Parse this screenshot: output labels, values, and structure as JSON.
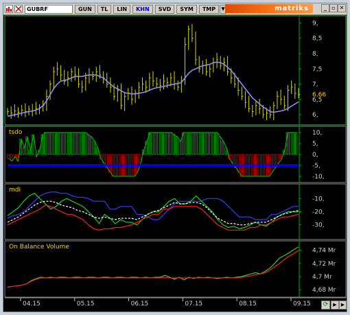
{
  "toolbar": {
    "symbol": "GUBRF",
    "buttons": [
      {
        "label": "GUN",
        "active": false
      },
      {
        "label": "TL",
        "active": false
      },
      {
        "label": "LIN",
        "active": false
      },
      {
        "label": "KHN",
        "active": true
      },
      {
        "label": "SVD",
        "active": false
      },
      {
        "label": "SYM",
        "active": false
      },
      {
        "label": "TMP",
        "active": false
      }
    ],
    "brand": "matriks",
    "dropdown_glyph": "▼",
    "refresh_glyph": "⟳"
  },
  "colors": {
    "price_bars": "#d8d800",
    "moving_average": "#8f8fff",
    "tsdo_up": "#00c000",
    "tsdo_down": "#e00000",
    "tsdo_signal": "#0000ff",
    "mdi_blue": "#3040ff",
    "mdi_green": "#20d020",
    "mdi_red": "#ff2020",
    "mdi_mid": "#ffffff",
    "obv_green": "#30d030",
    "obv_red": "#ff2020",
    "axis": "#00b000",
    "last_price": "#ffd000"
  },
  "chart_data": [
    {
      "type": "line",
      "name": "price",
      "xtick_labels": [
        "04.15",
        "05.15",
        "06.15",
        "07.15",
        "08.15",
        "09.15"
      ],
      "yticks": [
        "9,",
        "8,5",
        "8,",
        "7,5",
        "7,",
        "6,5",
        "6,"
      ],
      "ylim": [
        5.8,
        9.1
      ],
      "last_price_label": "6,66",
      "close": [
        6.1,
        6.05,
        6.12,
        6.08,
        6.15,
        6.1,
        6.18,
        6.12,
        6.2,
        6.22,
        6.3,
        6.6,
        7.0,
        7.4,
        7.5,
        7.3,
        7.1,
        7.2,
        7.4,
        7.3,
        7.0,
        6.9,
        7.2,
        7.3,
        7.25,
        7.4,
        7.3,
        7.2,
        7.0,
        6.9,
        6.6,
        6.8,
        6.3,
        6.6,
        6.7,
        6.5,
        6.7,
        6.9,
        7.0,
        6.9,
        7.2,
        7.1,
        7.0,
        6.95,
        7.1,
        7.05,
        7.2,
        7.0,
        6.9,
        7.1,
        8.3,
        8.8,
        8.5,
        7.8,
        7.5,
        7.6,
        7.4,
        7.5,
        7.7,
        7.8,
        7.6,
        7.7,
        7.4,
        7.2,
        7.0,
        6.8,
        6.6,
        6.4,
        6.2,
        6.1,
        6.3,
        6.2,
        6.0,
        6.05,
        6.0,
        6.3,
        6.6,
        6.5,
        6.3,
        6.8,
        6.9,
        6.7,
        6.66
      ],
      "moving_average": [
        5.95,
        5.97,
        6.0,
        6.02,
        6.05,
        6.08,
        6.1,
        6.12,
        6.15,
        6.2,
        6.3,
        6.45,
        6.65,
        6.85,
        7.0,
        7.1,
        7.12,
        7.15,
        7.2,
        7.25,
        7.25,
        7.25,
        7.28,
        7.3,
        7.3,
        7.3,
        7.25,
        7.2,
        7.1,
        7.0,
        6.9,
        6.85,
        6.78,
        6.72,
        6.7,
        6.68,
        6.68,
        6.7,
        6.72,
        6.75,
        6.8,
        6.85,
        6.88,
        6.9,
        6.92,
        6.95,
        6.98,
        7.0,
        7.02,
        7.05,
        7.2,
        7.35,
        7.45,
        7.5,
        7.55,
        7.6,
        7.62,
        7.65,
        7.7,
        7.72,
        7.7,
        7.65,
        7.55,
        7.45,
        7.3,
        7.15,
        7.0,
        6.85,
        6.7,
        6.55,
        6.45,
        6.35,
        6.25,
        6.18,
        6.1,
        6.08,
        6.1,
        6.12,
        6.15,
        6.2,
        6.28,
        6.35,
        6.42
      ]
    },
    {
      "type": "bar",
      "name": "tsdo",
      "title": "tsdo",
      "yticks": [
        "10,",
        "5,",
        "0,",
        "-5,",
        "-10,"
      ],
      "ylim": [
        -11,
        11
      ],
      "signal_level": -5,
      "values": [
        -2,
        -3,
        -1,
        -3,
        7,
        3,
        8,
        2,
        9,
        -1,
        2,
        9,
        10,
        10,
        10,
        10,
        10,
        10,
        10,
        10,
        10,
        10,
        10,
        10,
        10,
        10,
        9,
        8,
        6,
        3,
        -2,
        -4,
        -6,
        -8,
        -10,
        -10,
        -10,
        -10,
        -10,
        -10,
        -10,
        -10,
        -8,
        -4,
        2,
        6,
        10,
        10,
        10,
        10,
        10,
        10,
        10,
        10,
        9,
        8,
        6,
        10,
        10,
        10,
        10,
        10,
        10,
        10,
        10,
        10,
        10,
        10,
        10,
        8,
        6,
        3,
        -2,
        -4,
        -6,
        -8,
        -10,
        -10,
        -10,
        -10,
        -10,
        -10,
        -10,
        -10,
        -10,
        -10,
        -8,
        -6,
        -4,
        -2,
        2,
        10,
        10,
        10,
        10
      ]
    },
    {
      "type": "line",
      "name": "mdi",
      "title": "mdi",
      "yticks": [
        "-10,",
        "-20,",
        "-30,"
      ],
      "ylim": [
        -38,
        -2
      ],
      "series": [
        {
          "values": [
            -25,
            -23,
            -22,
            -20,
            -16,
            -12,
            -8,
            -6,
            -5,
            -5,
            -6,
            -6,
            -8,
            -9,
            -9,
            -10,
            -12,
            -12,
            -12,
            -18,
            -18,
            -16,
            -16,
            -16,
            -22,
            -22,
            -24,
            -26,
            -26,
            -22,
            -18,
            -14,
            -12,
            -12,
            -12,
            -12,
            -12,
            -10,
            -10,
            -10,
            -12,
            -16,
            -20,
            -24,
            -24,
            -24,
            -26,
            -26,
            -26,
            -22,
            -22,
            -20,
            -18,
            -16,
            -16
          ]
        },
        {
          "values": [
            -23,
            -20,
            -17,
            -12,
            -8,
            -6,
            -10,
            -14,
            -18,
            -16,
            -12,
            -10,
            -12,
            -14,
            -16,
            -20,
            -24,
            -29,
            -22,
            -25,
            -29,
            -26,
            -28,
            -28,
            -30,
            -26,
            -22,
            -20,
            -20,
            -16,
            -12,
            -10,
            -14,
            -14,
            -12,
            -8,
            -12,
            -16,
            -20,
            -26,
            -30,
            -32,
            -31,
            -33,
            -32,
            -30,
            -28,
            -30,
            -31,
            -28,
            -24,
            -22,
            -20,
            -20,
            -20
          ]
        },
        {
          "values": [
            -30,
            -28,
            -26,
            -24,
            -22,
            -20,
            -18,
            -15,
            -16,
            -18,
            -20,
            -22,
            -22,
            -24,
            -26,
            -30,
            -33,
            -34,
            -33,
            -33,
            -32,
            -32,
            -31,
            -30,
            -28,
            -26,
            -24,
            -22,
            -22,
            -18,
            -18,
            -16,
            -16,
            -16,
            -16,
            -16,
            -18,
            -22,
            -26,
            -30,
            -32,
            -34,
            -34,
            -34,
            -34,
            -32,
            -32,
            -30,
            -30,
            -28,
            -26,
            -24,
            -24,
            -23,
            -22
          ]
        },
        {
          "values": [
            -28,
            -26,
            -24,
            -21,
            -18,
            -15,
            -13,
            -12,
            -12,
            -13,
            -15,
            -16,
            -17,
            -19,
            -20,
            -22,
            -24,
            -25,
            -24,
            -25,
            -26,
            -25,
            -25,
            -25,
            -26,
            -24,
            -22,
            -20,
            -19,
            -17,
            -15,
            -13,
            -14,
            -14,
            -13,
            -13,
            -14,
            -17,
            -21,
            -25,
            -27,
            -29,
            -29,
            -30,
            -30,
            -29,
            -28,
            -28,
            -28,
            -26,
            -24,
            -22,
            -21,
            -20,
            -19
          ]
        }
      ]
    },
    {
      "type": "line",
      "name": "obv",
      "title": "On Balance Volume",
      "yticks": [
        "4,74 Mr",
        "4,72 Mr",
        "4,7 Mr",
        "4,68 Mr"
      ],
      "ylim": [
        4.675,
        4.748
      ],
      "series": [
        {
          "values": [
            4.684,
            4.685,
            4.686,
            4.687,
            4.689,
            4.694,
            4.697,
            4.699,
            4.698,
            4.699,
            4.698,
            4.699,
            4.699,
            4.698,
            4.699,
            4.699,
            4.698,
            4.699,
            4.699,
            4.698,
            4.699,
            4.699,
            4.698,
            4.699,
            4.699,
            4.698,
            4.699,
            4.699,
            4.698,
            4.699,
            4.698,
            4.699,
            4.699,
            4.702,
            4.699,
            4.696,
            4.699,
            4.695,
            4.699,
            4.697,
            4.699,
            4.698,
            4.699,
            4.698,
            4.697,
            4.698,
            4.699,
            4.698,
            4.699,
            4.7,
            4.702,
            4.704,
            4.706,
            4.704,
            4.708,
            4.713,
            4.72,
            4.728,
            4.732,
            4.736,
            4.741,
            4.745
          ]
        },
        {
          "values": [
            4.684,
            4.685,
            4.686,
            4.687,
            4.689,
            4.693,
            4.696,
            4.698,
            4.698,
            4.698,
            4.698,
            4.698,
            4.698,
            4.698,
            4.698,
            4.698,
            4.698,
            4.698,
            4.698,
            4.698,
            4.698,
            4.698,
            4.698,
            4.698,
            4.698,
            4.698,
            4.698,
            4.698,
            4.698,
            4.698,
            4.698,
            4.698,
            4.698,
            4.699,
            4.698,
            4.698,
            4.698,
            4.698,
            4.698,
            4.698,
            4.698,
            4.698,
            4.698,
            4.698,
            4.698,
            4.698,
            4.698,
            4.698,
            4.698,
            4.699,
            4.7,
            4.701,
            4.703,
            4.704,
            4.706,
            4.71,
            4.715,
            4.72,
            4.726,
            4.731,
            4.735,
            4.74
          ]
        }
      ]
    }
  ]
}
